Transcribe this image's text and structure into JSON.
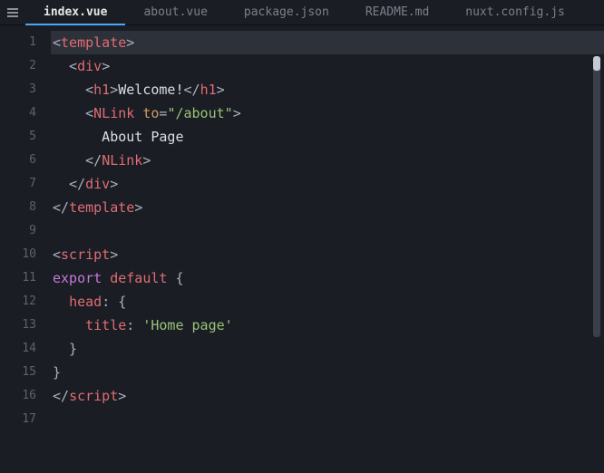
{
  "tabs": [
    {
      "label": "index.vue",
      "active": true
    },
    {
      "label": "about.vue",
      "active": false
    },
    {
      "label": "package.json",
      "active": false
    },
    {
      "label": "README.md",
      "active": false
    },
    {
      "label": "nuxt.config.js",
      "active": false
    }
  ],
  "lineNumbers": [
    "1",
    "2",
    "3",
    "4",
    "5",
    "6",
    "7",
    "8",
    "9",
    "10",
    "11",
    "12",
    "13",
    "14",
    "15",
    "16",
    "17"
  ],
  "code": [
    {
      "hl": true,
      "tokens": [
        [
          "p",
          "<"
        ],
        [
          "t",
          "template"
        ],
        [
          "p",
          ">"
        ]
      ]
    },
    {
      "hl": false,
      "tokens": [
        [
          "p",
          "  <"
        ],
        [
          "t",
          "div"
        ],
        [
          "p",
          ">"
        ]
      ]
    },
    {
      "hl": false,
      "tokens": [
        [
          "p",
          "    <"
        ],
        [
          "t",
          "h1"
        ],
        [
          "p",
          ">"
        ],
        [
          "tx",
          "Welcome!"
        ],
        [
          "p",
          "</"
        ],
        [
          "t",
          "h1"
        ],
        [
          "p",
          ">"
        ]
      ]
    },
    {
      "hl": false,
      "tokens": [
        [
          "p",
          "    <"
        ],
        [
          "t",
          "NLink"
        ],
        [
          "p",
          " "
        ],
        [
          "a",
          "to"
        ],
        [
          "p",
          "="
        ],
        [
          "s",
          "\"/about\""
        ],
        [
          "p",
          ">"
        ]
      ]
    },
    {
      "hl": false,
      "tokens": [
        [
          "tx",
          "      About Page"
        ]
      ]
    },
    {
      "hl": false,
      "tokens": [
        [
          "p",
          "    </"
        ],
        [
          "t",
          "NLink"
        ],
        [
          "p",
          ">"
        ]
      ]
    },
    {
      "hl": false,
      "tokens": [
        [
          "p",
          "  </"
        ],
        [
          "t",
          "div"
        ],
        [
          "p",
          ">"
        ]
      ]
    },
    {
      "hl": false,
      "tokens": [
        [
          "p",
          "</"
        ],
        [
          "t",
          "template"
        ],
        [
          "p",
          ">"
        ]
      ]
    },
    {
      "hl": false,
      "tokens": []
    },
    {
      "hl": false,
      "tokens": [
        [
          "p",
          "<"
        ],
        [
          "t",
          "script"
        ],
        [
          "p",
          ">"
        ]
      ]
    },
    {
      "hl": false,
      "tokens": [
        [
          "k",
          "export"
        ],
        [
          "p",
          " "
        ],
        [
          "k2",
          "default"
        ],
        [
          "p",
          " {"
        ]
      ]
    },
    {
      "hl": false,
      "tokens": [
        [
          "p",
          "  "
        ],
        [
          "pr",
          "head"
        ],
        [
          "p",
          ": {"
        ]
      ]
    },
    {
      "hl": false,
      "tokens": [
        [
          "p",
          "    "
        ],
        [
          "pr",
          "title"
        ],
        [
          "p",
          ": "
        ],
        [
          "s",
          "'Home page'"
        ]
      ]
    },
    {
      "hl": false,
      "tokens": [
        [
          "p",
          "  }"
        ]
      ]
    },
    {
      "hl": false,
      "tokens": [
        [
          "p",
          "}"
        ]
      ]
    },
    {
      "hl": false,
      "tokens": [
        [
          "p",
          "</"
        ],
        [
          "t",
          "script"
        ],
        [
          "p",
          ">"
        ]
      ]
    },
    {
      "hl": false,
      "tokens": []
    }
  ]
}
